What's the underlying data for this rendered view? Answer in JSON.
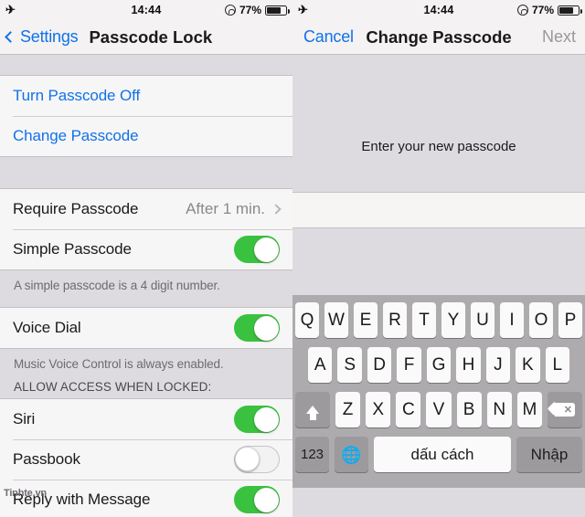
{
  "status_bar": {
    "airplane_icon": "airplane-mode-icon",
    "time": "14:44",
    "rotation_lock_icon": "rotation-lock-icon",
    "battery_percent": "77%",
    "battery_icon": "battery-icon"
  },
  "left_screen": {
    "nav": {
      "back_label": "Settings",
      "back_icon": "chevron-left-icon",
      "title": "Passcode Lock"
    },
    "group1": [
      {
        "label": "Turn Passcode Off",
        "type": "link"
      },
      {
        "label": "Change Passcode",
        "type": "link"
      }
    ],
    "group2": [
      {
        "label": "Require Passcode",
        "value": "After 1 min.",
        "type": "disclosure"
      },
      {
        "label": "Simple Passcode",
        "type": "toggle",
        "state": "on"
      }
    ],
    "footnote1": "A simple passcode is a 4 digit number.",
    "group3": [
      {
        "label": "Voice Dial",
        "type": "toggle",
        "state": "on"
      }
    ],
    "footnote2": "Music Voice Control is always enabled.",
    "section_header": "ALLOW ACCESS WHEN LOCKED:",
    "group4": [
      {
        "label": "Siri",
        "type": "toggle",
        "state": "on"
      },
      {
        "label": "Passbook",
        "type": "toggle",
        "state": "off"
      },
      {
        "label": "Reply with Message",
        "type": "toggle",
        "state": "on"
      }
    ],
    "watermark": "Tinhte.vn"
  },
  "right_screen": {
    "nav": {
      "cancel_label": "Cancel",
      "title": "Change Passcode",
      "next_label": "Next"
    },
    "prompt": "Enter your new passcode",
    "passcode_value": "",
    "keyboard": {
      "row1": [
        "Q",
        "W",
        "E",
        "R",
        "T",
        "Y",
        "U",
        "I",
        "O",
        "P"
      ],
      "row2": [
        "A",
        "S",
        "D",
        "F",
        "G",
        "H",
        "J",
        "K",
        "L"
      ],
      "row3": [
        "Z",
        "X",
        "C",
        "V",
        "B",
        "N",
        "M"
      ],
      "shift_icon": "shift-arrow-up-icon",
      "delete_icon": "backspace-delete-icon",
      "numbers_label": "123",
      "globe_icon": "globe-language-icon",
      "space_label": "dấu cách",
      "return_label": "Nhập"
    }
  },
  "colors": {
    "accent_blue": "#1072e8",
    "toggle_on_green": "#3ac13f",
    "disabled_gray": "#9b979b"
  }
}
